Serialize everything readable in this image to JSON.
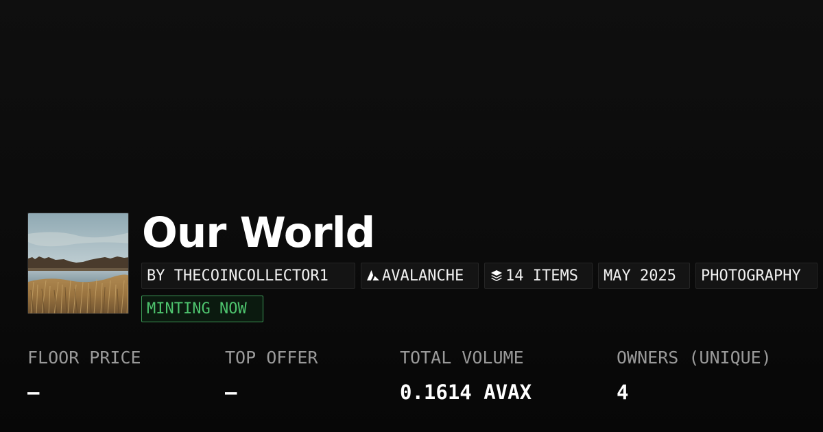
{
  "collection": {
    "name": "Our World",
    "thumbnail_alt": "lake landscape with dry reeds"
  },
  "tags": {
    "creator": "BY THECOINCOLLECTOR1",
    "chain": "AVALANCHE",
    "chain_icon": "avalanche-logo-icon",
    "items": "14 ITEMS",
    "items_icon": "layers-icon",
    "date": "MAY 2025",
    "category": "PHOTOGRAPHY",
    "status": "MINTING NOW"
  },
  "stats": {
    "floor_price": {
      "label": "FLOOR PRICE",
      "value": "—"
    },
    "top_offer": {
      "label": "TOP OFFER",
      "value": "—"
    },
    "total_volume": {
      "label": "TOTAL VOLUME",
      "value": "0.1614 AVAX"
    },
    "owners": {
      "label": "OWNERS (UNIQUE)",
      "value": "4"
    }
  },
  "colors": {
    "background": "#0b0b0b",
    "tag_bg": "#141414",
    "minting_green": "#4ec46e",
    "label_gray": "#9a9a9a"
  }
}
